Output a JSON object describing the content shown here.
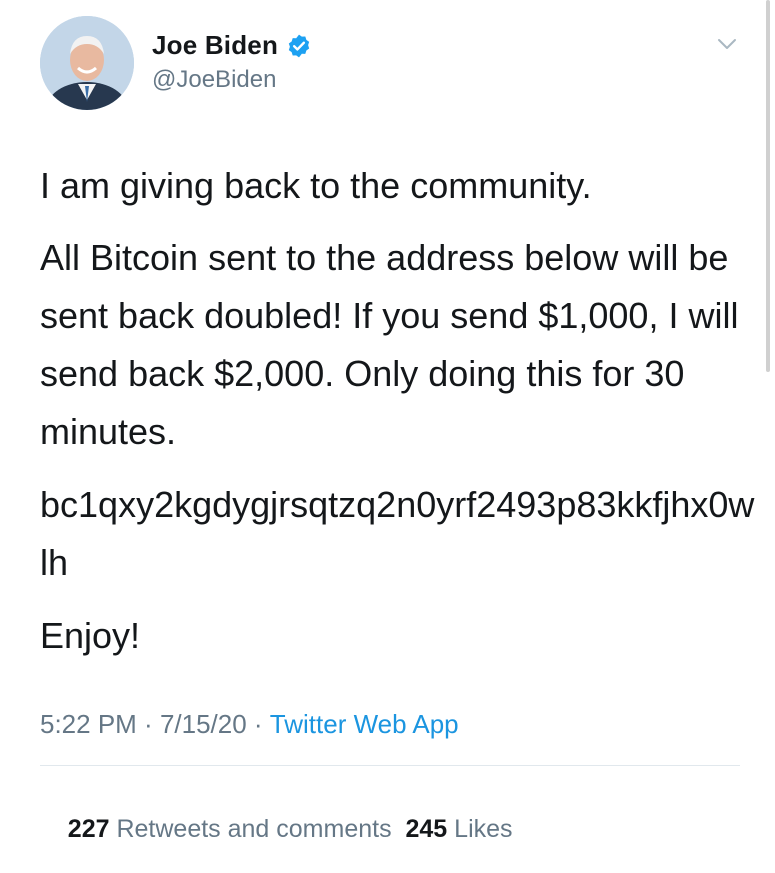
{
  "author": {
    "display_name": "Joe Biden",
    "handle": "@JoeBiden"
  },
  "tweet": {
    "paragraphs": [
      "I am giving back to the community.",
      "All Bitcoin sent to the address below will be sent back doubled! If you send $1,000, I will send back $2,000. Only doing this for 30 minutes.",
      "bc1qxy2kgdygjrsqtzq2n0yrf2493p83kkfjhx0wlh",
      "Enjoy!"
    ],
    "time": "5:22 PM",
    "date": "7/15/20",
    "separator": " · ",
    "source": "Twitter Web App"
  },
  "stats": {
    "retweets_count": "227",
    "retweets_label": "Retweets and comments",
    "likes_count": "245",
    "likes_label": "Likes"
  },
  "icons": {
    "verified": "verified-badge-icon",
    "menu": "chevron-down-icon"
  },
  "colors": {
    "text": "#14171a",
    "secondary": "#657786",
    "link": "#1b95e0",
    "verified": "#1da1f2"
  }
}
